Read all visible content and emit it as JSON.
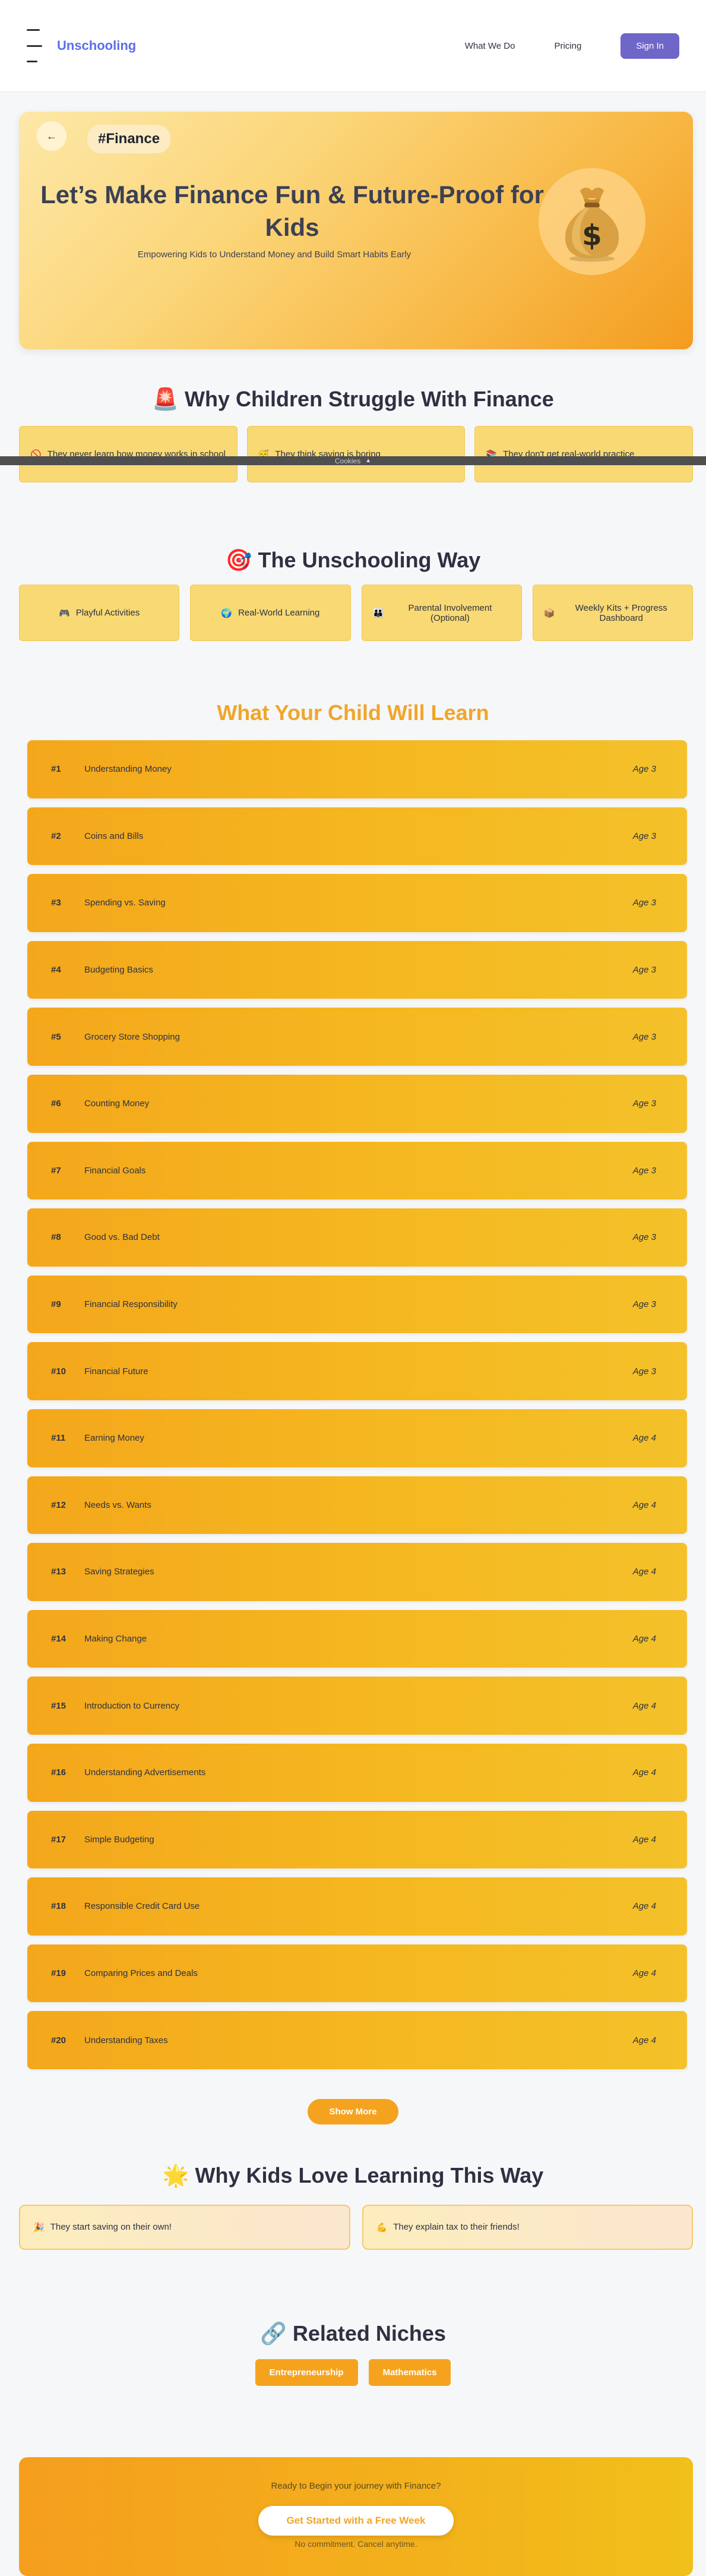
{
  "header": {
    "logo": "Unschooling",
    "nav": [
      "What We Do",
      "Pricing"
    ],
    "signin": "Sign In"
  },
  "hero": {
    "back_icon": "arrow-left-icon",
    "tag": "#Finance",
    "title": "Let’s Make Finance Fun & Future-Proof for Kids",
    "subtitle": "Empowering Kids to Understand Money and Build Smart Habits Early",
    "image_icon": "money-bag-icon"
  },
  "struggle": {
    "title": "🚨 Why Children Struggle With Finance",
    "cards": [
      {
        "emoji": "🚫",
        "text": "They never learn how money works in school"
      },
      {
        "emoji": "😴",
        "text": "They think saving is boring"
      },
      {
        "emoji": "📚",
        "text": "They don't get real-world practice"
      }
    ]
  },
  "cookie_bar": {
    "label": "Cookies",
    "icon": "chevron-up-icon"
  },
  "way": {
    "title": "🎯 The Unschooling Way",
    "cards": [
      {
        "emoji": "🎮",
        "text": "Playful Activities"
      },
      {
        "emoji": "🌍",
        "text": "Real-World Learning"
      },
      {
        "emoji": "👪",
        "text": "Parental Involvement (Optional)"
      },
      {
        "emoji": "📦",
        "text": "Weekly Kits + Progress Dashboard"
      }
    ]
  },
  "learn": {
    "title": "What Your Child Will Learn",
    "items": [
      {
        "num": "#1",
        "topic": "Understanding Money",
        "age": "Age 3"
      },
      {
        "num": "#2",
        "topic": "Coins and Bills",
        "age": "Age 3"
      },
      {
        "num": "#3",
        "topic": "Spending vs. Saving",
        "age": "Age 3"
      },
      {
        "num": "#4",
        "topic": "Budgeting Basics",
        "age": "Age 3"
      },
      {
        "num": "#5",
        "topic": "Grocery Store Shopping",
        "age": "Age 3"
      },
      {
        "num": "#6",
        "topic": "Counting Money",
        "age": "Age 3"
      },
      {
        "num": "#7",
        "topic": "Financial Goals",
        "age": "Age 3"
      },
      {
        "num": "#8",
        "topic": "Good vs. Bad Debt",
        "age": "Age 3"
      },
      {
        "num": "#9",
        "topic": "Financial Responsibility",
        "age": "Age 3"
      },
      {
        "num": "#10",
        "topic": "Financial Future",
        "age": "Age 3"
      },
      {
        "num": "#11",
        "topic": "Earning Money",
        "age": "Age 4"
      },
      {
        "num": "#12",
        "topic": "Needs vs. Wants",
        "age": "Age 4"
      },
      {
        "num": "#13",
        "topic": "Saving Strategies",
        "age": "Age 4"
      },
      {
        "num": "#14",
        "topic": "Making Change",
        "age": "Age 4"
      },
      {
        "num": "#15",
        "topic": "Introduction to Currency",
        "age": "Age 4"
      },
      {
        "num": "#16",
        "topic": "Understanding Advertisements",
        "age": "Age 4"
      },
      {
        "num": "#17",
        "topic": "Simple Budgeting",
        "age": "Age 4"
      },
      {
        "num": "#18",
        "topic": "Responsible Credit Card Use",
        "age": "Age 4"
      },
      {
        "num": "#19",
        "topic": "Comparing Prices and Deals",
        "age": "Age 4"
      },
      {
        "num": "#20",
        "topic": "Understanding Taxes",
        "age": "Age 4"
      }
    ],
    "show_more": "Show More"
  },
  "love": {
    "title": "🌟 Why Kids Love Learning This Way",
    "cards": [
      {
        "emoji": "🎉",
        "text": "They start saving on their own!"
      },
      {
        "emoji": "💪",
        "text": "They explain tax to their friends!"
      }
    ]
  },
  "related": {
    "title": "🔗 Related Niches",
    "niches": [
      "Entrepreneurship",
      "Mathematics"
    ]
  },
  "cta": {
    "text": "Ready to Begin your journey with Finance?",
    "button": "Get Started with a Free Week",
    "note": "No commitment. Cancel anytime."
  },
  "colors": {
    "brand_blue": "#5b6ee8",
    "signin_purple": "#6f66c9",
    "accent_orange": "#f5a31e",
    "card_yellow": "#f8d974"
  }
}
